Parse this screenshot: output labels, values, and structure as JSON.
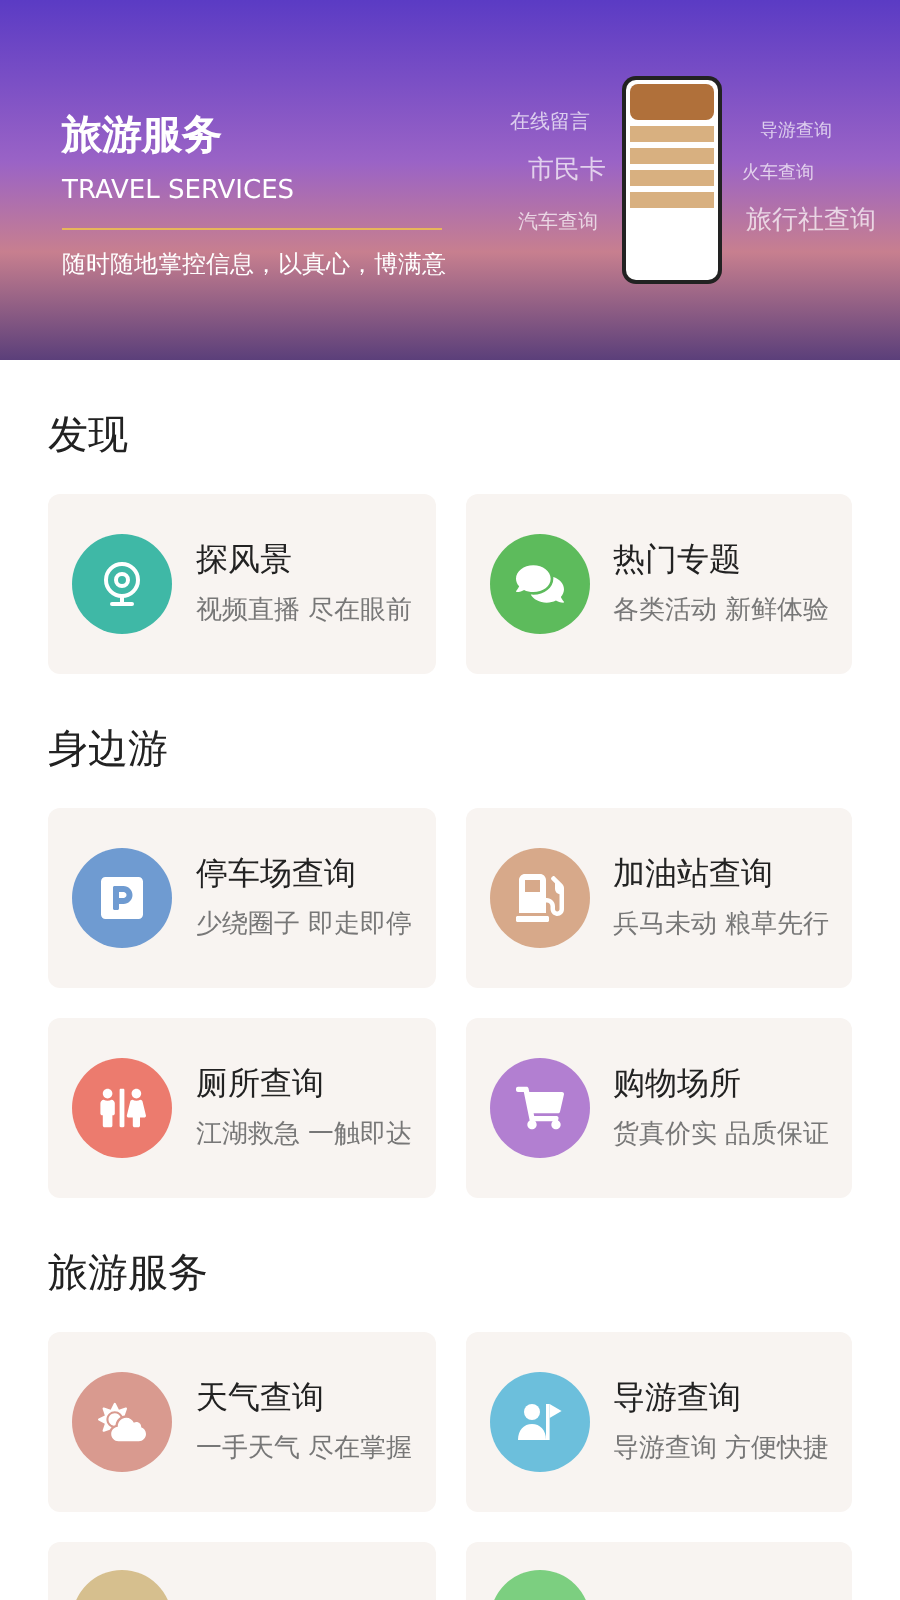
{
  "banner": {
    "title": "旅游服务",
    "subtitle": "TRAVEL SERVICES",
    "slogan": "随时随地掌控信息，以真心，博满意",
    "floating_labels": [
      "在线留言",
      "市民卡",
      "汽车查询",
      "导游查询",
      "火车查询",
      "旅行社查询"
    ]
  },
  "sections": [
    {
      "title": "发现",
      "items": [
        {
          "title": "探风景",
          "subtitle": "视频直播 尽在眼前",
          "color": "#3fb8a6"
        },
        {
          "title": "热门专题",
          "subtitle": "各类活动 新鲜体验",
          "color": "#5dbb5c"
        }
      ]
    },
    {
      "title": "身边游",
      "items": [
        {
          "title": "停车场查询",
          "subtitle": "少绕圈子 即走即停",
          "color": "#6f9bd1"
        },
        {
          "title": "加油站查询",
          "subtitle": "兵马未动 粮草先行",
          "color": "#d7a98a"
        },
        {
          "title": "厕所查询",
          "subtitle": "江湖救急 一触即达",
          "color": "#ec7b6e"
        },
        {
          "title": "购物场所",
          "subtitle": "货真价实 品质保证",
          "color": "#b27fd1"
        }
      ]
    },
    {
      "title": "旅游服务",
      "items": [
        {
          "title": "天气查询",
          "subtitle": "一手天气 尽在掌握",
          "color": "#d99a8f"
        },
        {
          "title": "导游查询",
          "subtitle": "导游查询 方便快捷",
          "color": "#6cbfdc"
        }
      ],
      "partial_cards": [
        {
          "color": "#d6bf8e"
        },
        {
          "color": "#7ccf80"
        }
      ]
    }
  ]
}
